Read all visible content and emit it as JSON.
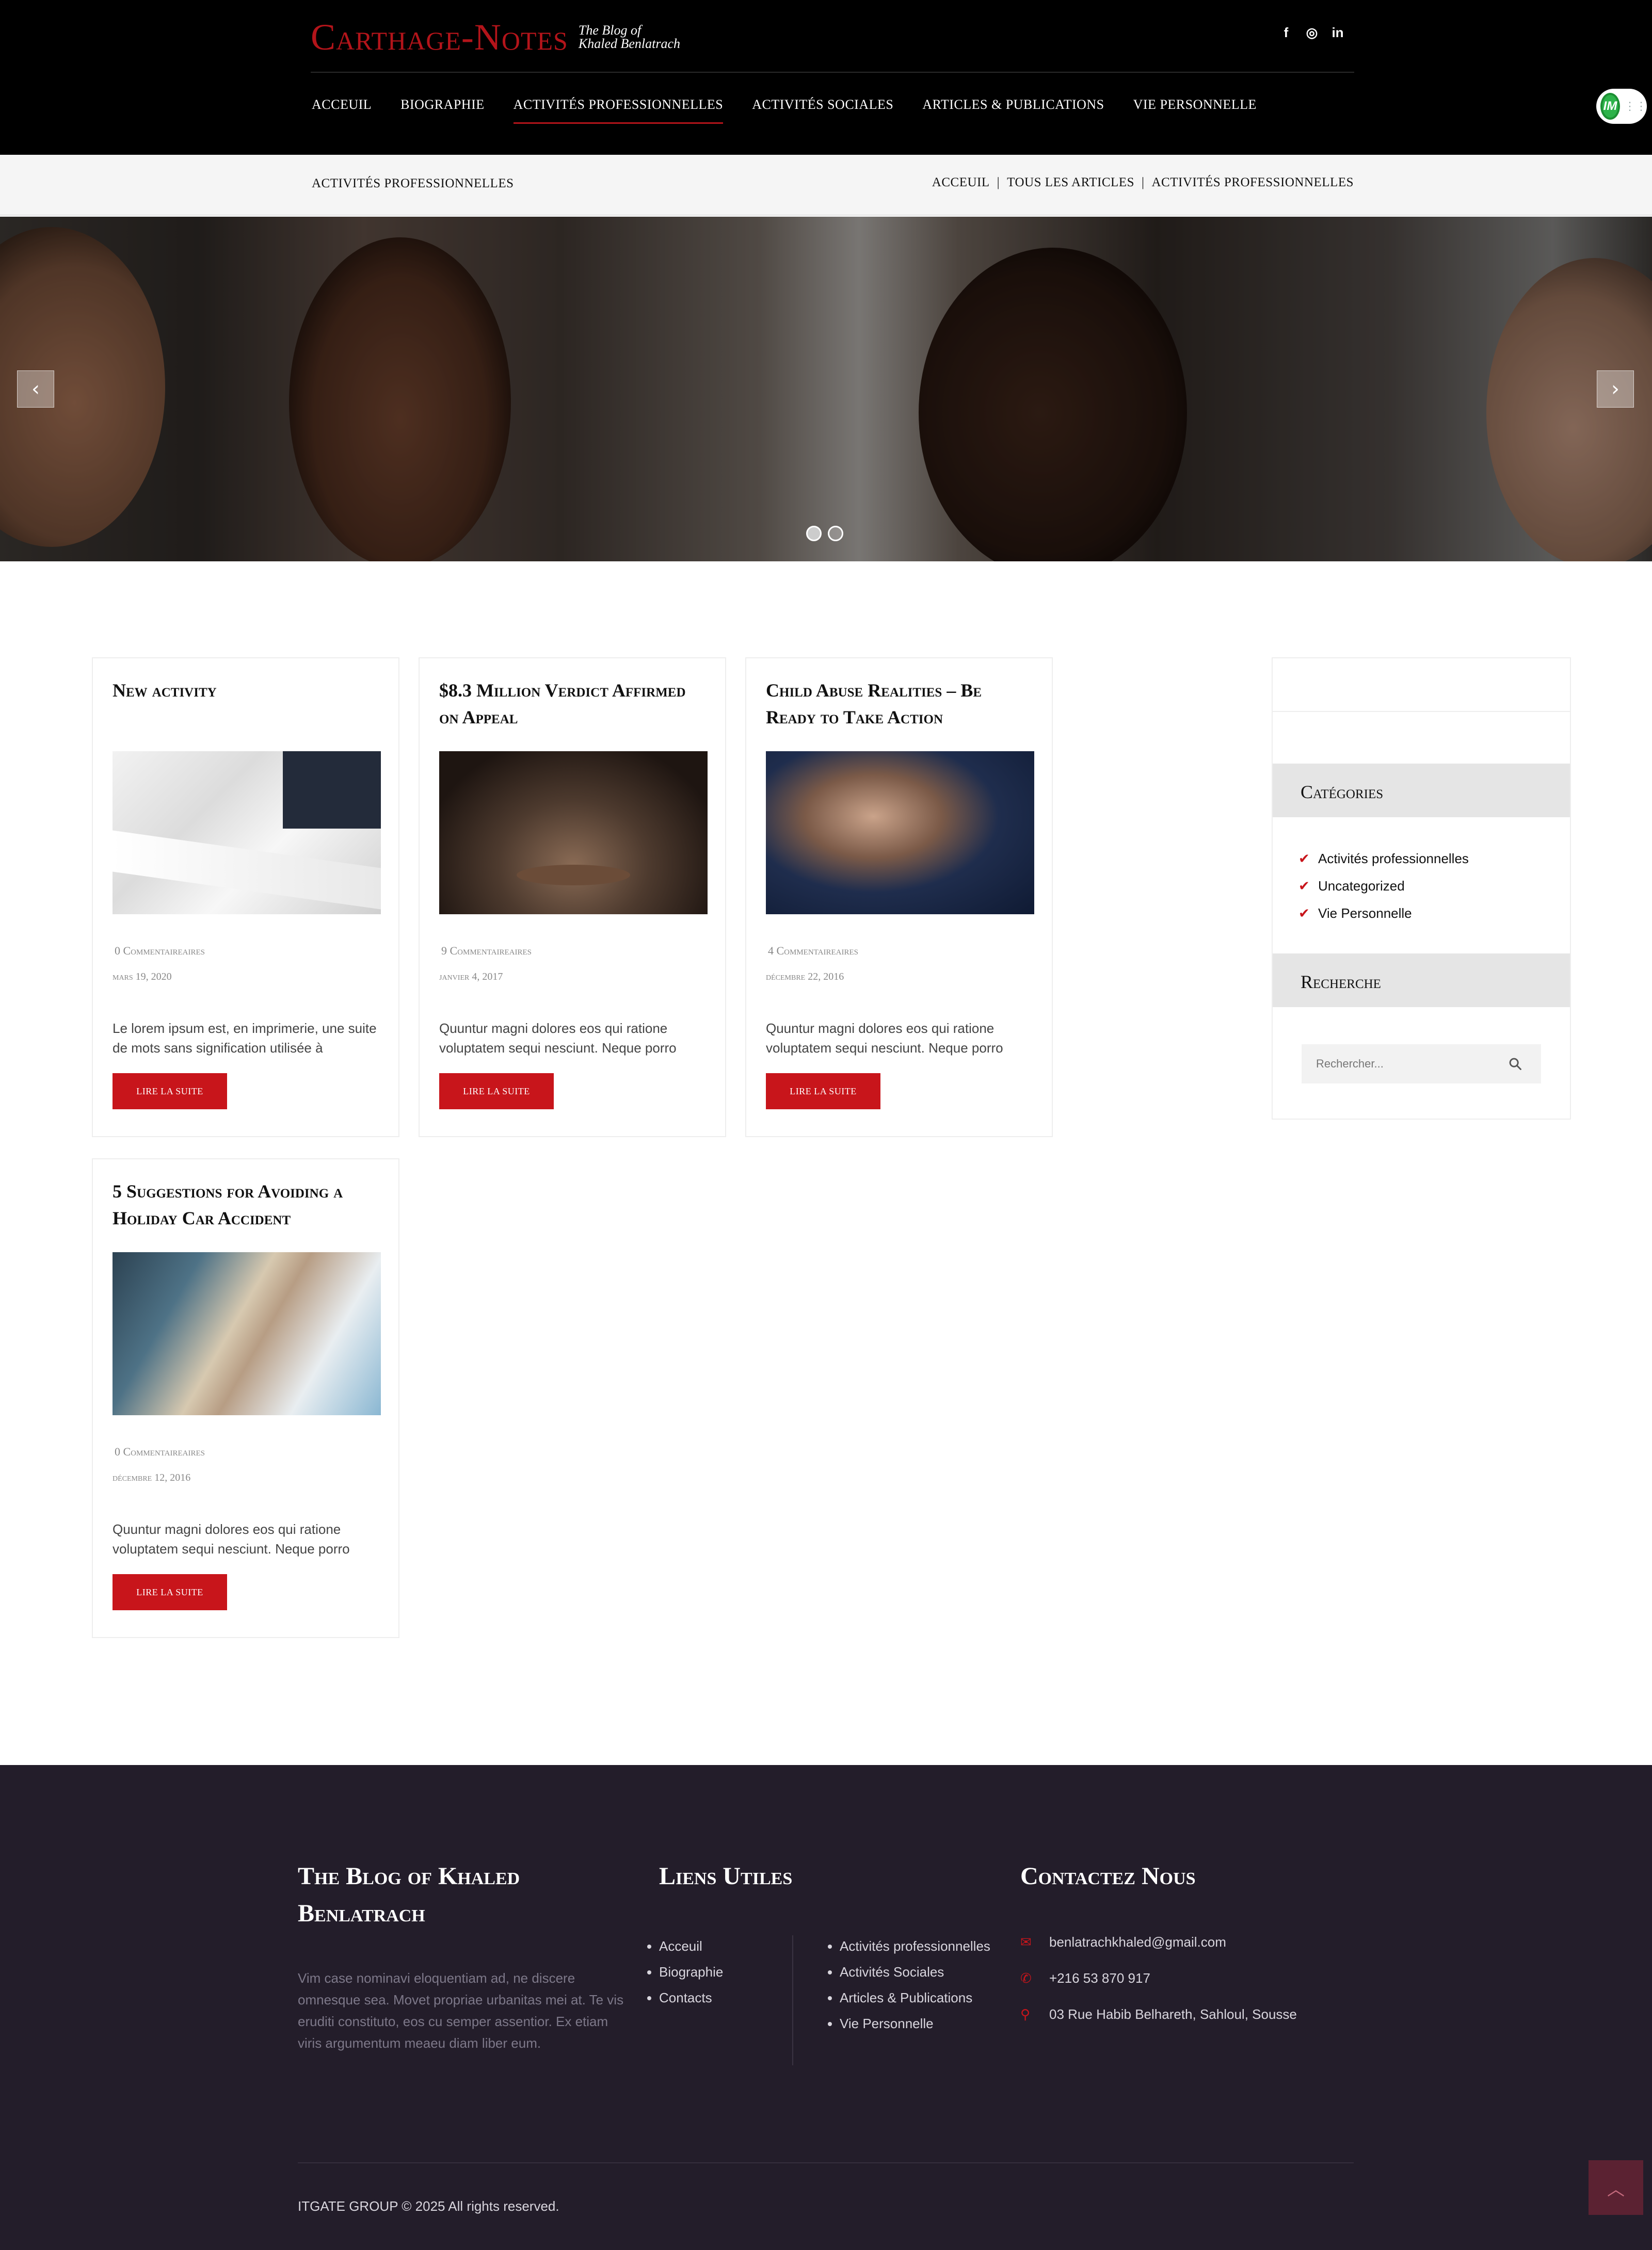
{
  "header": {
    "logo_main": "Carthage-Notes",
    "logo_sub_line1": "The Blog of",
    "logo_sub_line2": "Khaled Benlatrach",
    "social": [
      {
        "icon": "facebook-icon",
        "glyph": "f"
      },
      {
        "icon": "instagram-icon",
        "glyph": "◎"
      },
      {
        "icon": "linkedin-icon",
        "glyph": "in"
      }
    ],
    "nav": [
      {
        "label": "ACCEUIL",
        "active": false
      },
      {
        "label": "BIOGRAPHIE",
        "active": false
      },
      {
        "label": "ACTIVITÉS PROFESSIONNELLES",
        "active": true
      },
      {
        "label": "ACTIVITÉS SOCIALES",
        "active": false
      },
      {
        "label": "ARTICLES & PUBLICATIONS",
        "active": false
      },
      {
        "label": "VIE PERSONNELLE",
        "active": false
      }
    ],
    "toggle_label": "IM"
  },
  "breadcrumb_bar": {
    "page_title": "ACTIVITÉS PROFESSIONNELLES",
    "crumbs": [
      "ACCEUIL",
      "TOUS LES ARTICLES",
      "ACTIVITÉS PROFESSIONNELLES"
    ],
    "separator": "|"
  },
  "slider": {
    "prev_glyph": "‹",
    "next_glyph": "›",
    "slide_count": 2,
    "active_slide": 1
  },
  "posts": [
    {
      "title": "New activity",
      "comments": "0 Commentaireaires",
      "date": "mars 19, 2020",
      "excerpt": "Le lorem ipsum est, en imprimerie, une suite de mots sans signification utilisée à",
      "button": "LIRE LA SUITE"
    },
    {
      "title": "$8.3 Million Verdict Affirmed on Appeal",
      "comments": "9 Commentaireaires",
      "date": "janvier 4, 2017",
      "excerpt": "Quuntur magni dolores eos qui ratione voluptatem sequi nesciunt. Neque porro",
      "button": "LIRE LA SUITE"
    },
    {
      "title": "Child Abuse Realities – Be Ready to Take Action",
      "comments": "4 Commentaireaires",
      "date": "décembre 22, 2016",
      "excerpt": "Quuntur magni dolores eos qui ratione voluptatem sequi nesciunt. Neque porro",
      "button": "LIRE LA SUITE"
    },
    {
      "title": "5 Suggestions for Avoiding a Holiday Car Accident",
      "comments": "0 Commentaireaires",
      "date": "décembre 12, 2016",
      "excerpt": "Quuntur magni dolores eos qui ratione voluptatem sequi nesciunt. Neque porro",
      "button": "LIRE LA SUITE"
    }
  ],
  "sidebar": {
    "categories_title": "Catégories",
    "categories": [
      "Activités professionnelles",
      "Uncategorized",
      "Vie Personnelle"
    ],
    "search_title": "Recherche",
    "search_placeholder": "Rechercher..."
  },
  "footer": {
    "about_title": "The Blog of Khaled Benlatrach",
    "about_text": "Vim case nominavi eloquentiam ad, ne discere omnesque sea. Movet propriae urbanitas mei at. Te vis eruditi constituto, eos cu semper assentior. Ex etiam viris argumentum meaeu diam liber eum.",
    "links_title": "Liens Utiles",
    "links_col1": [
      "Acceuil",
      "Biographie",
      "Contacts"
    ],
    "links_col2": [
      "Activités professionnelles",
      "Activités Sociales",
      "Articles & Publications",
      "Vie Personnelle"
    ],
    "contact_title": "Contactez Nous",
    "email": "benlatrachkhaled@gmail.com",
    "phone": "+216 53 870 917",
    "address": "03 Rue Habib Belhareth, Sahloul, Sousse",
    "copyright": "ITGATE GROUP © 2025 All rights reserved."
  },
  "colors": {
    "accent_red": "#c8151b",
    "header_bg": "#000000",
    "footer_bg": "#231d2a"
  }
}
